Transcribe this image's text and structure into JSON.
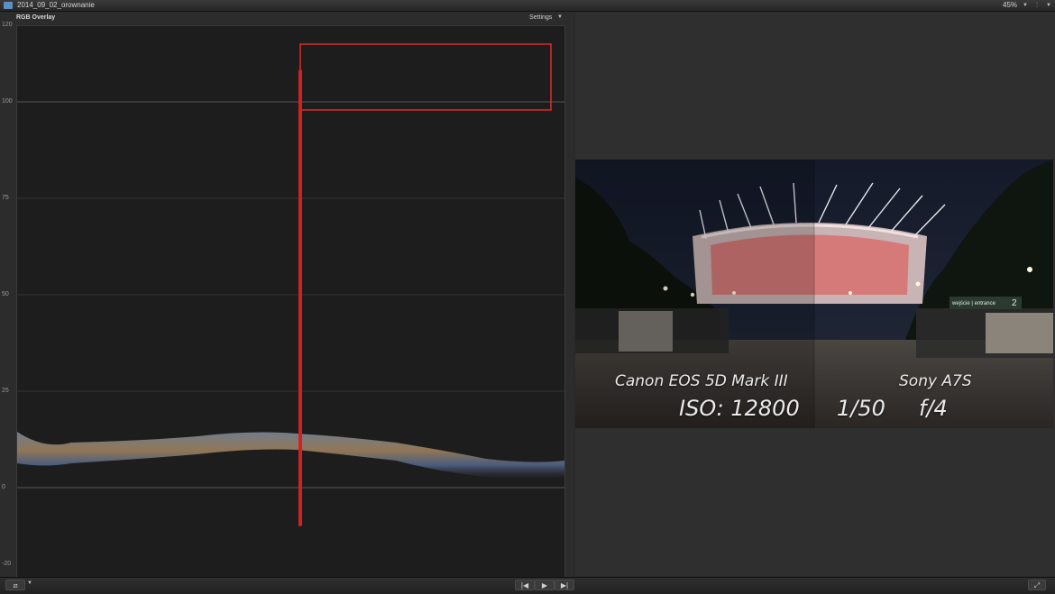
{
  "titlebar": {
    "project_name": "2014_09_02_orownanie",
    "zoom": "45%"
  },
  "scope": {
    "title": "RGB Overlay",
    "settings_label": "Settings",
    "y_ticks": [
      "120",
      "100",
      "75",
      "50",
      "25",
      "0",
      "-20"
    ]
  },
  "viewer": {
    "camera_left": "Canon EOS 5D Mark III",
    "camera_right": "Sony A7S",
    "iso": "ISO: 12800",
    "shutter": "1/50",
    "aperture": "f/4",
    "sign_text": "wejście | entrance",
    "sign_number": "2"
  },
  "icons": {
    "project": "film-icon",
    "view_mode": "waveform-view-icon",
    "play": "play-icon",
    "prev": "skip-back-icon",
    "next": "skip-forward-icon",
    "fullscreen": "fullscreen-icon"
  }
}
